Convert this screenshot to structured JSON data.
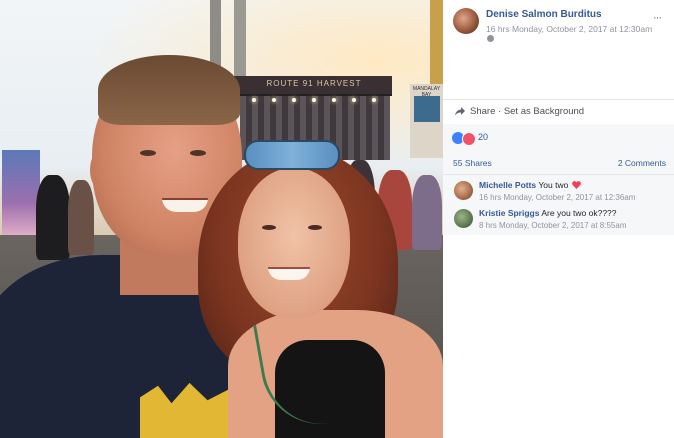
{
  "photo": {
    "description_alt": "Selfie of a couple at an outdoor music festival",
    "stage_sign": "ROUTE 91 HARVEST",
    "screen_label": "MANDALAY BAY"
  },
  "post": {
    "author": "Denise Salmon Burditus",
    "timestamp": "16 hrs Monday, October 2, 2017 at 12:30am",
    "share_label": "Share",
    "share_sep": "·",
    "set_background_label": "Set as Background",
    "reaction_count": "20",
    "shares": "55 Shares",
    "comments_count": "2 Comments"
  },
  "comments": [
    {
      "name": "Michelle Potts",
      "text": "You two",
      "time": "16 hrs Monday, October 2, 2017 at 12:36am",
      "has_heart": true
    },
    {
      "name": "Kristie Spriggs",
      "text": "Are you two ok????",
      "time": "8 hrs Monday, October 2, 2017 at 8:55am",
      "has_heart": false
    }
  ],
  "colors": {
    "link": "#365899",
    "meta": "#90949c",
    "like": "#4080ff",
    "love": "#f25268"
  }
}
